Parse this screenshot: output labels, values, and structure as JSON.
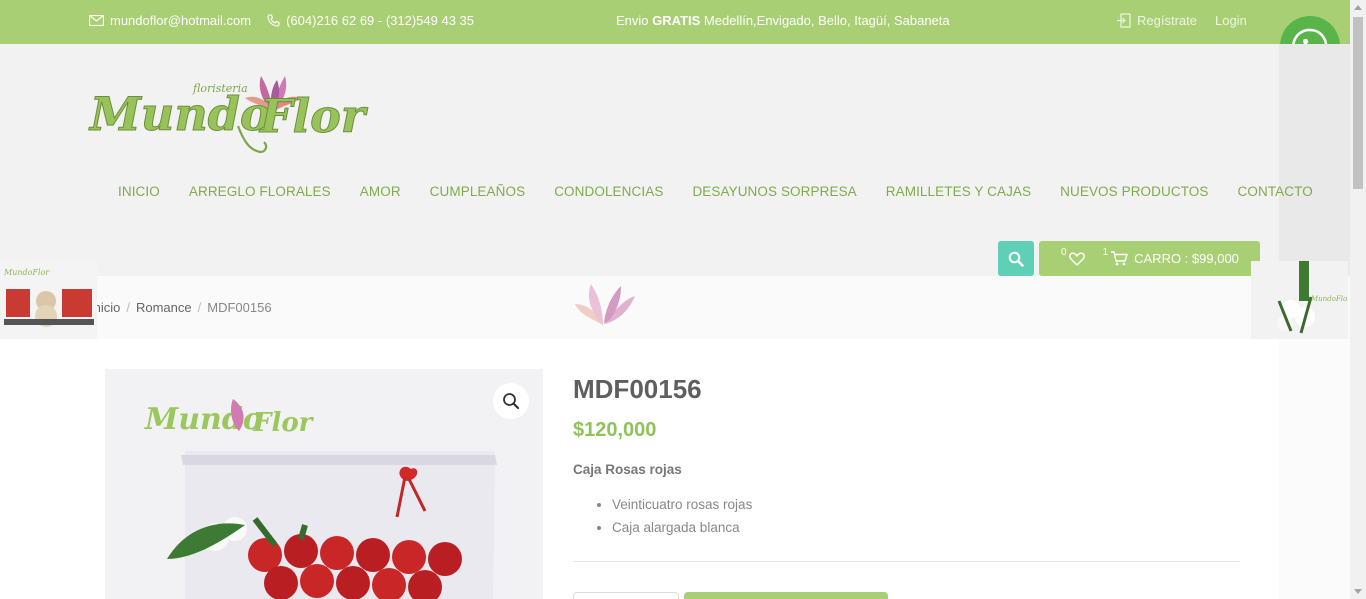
{
  "topbar": {
    "email": "mundoflor@hotmail.com",
    "phones": "(604)216 62 69 - (312)549 43 35",
    "promo_prefix": "Envio ",
    "promo_bold": "GRATIS",
    "promo_rest": " Medellín,Envigado, Bello, Itagüí, Sabaneta",
    "register_label": "Regístrate",
    "login_label": "Login"
  },
  "nav": {
    "items": [
      "INICIO",
      "ARREGLO FLORALES",
      "AMOR",
      "CUMPLEAÑOS",
      "CONDOLENCIAS",
      "DESAYUNOS SORPRESA",
      "RAMILLETES Y CAJAS",
      "NUEVOS PRODUCTOS",
      "CONTACTO"
    ]
  },
  "cart": {
    "wishlist_count": "0",
    "cart_count": "1",
    "label": "CARRO : $99,000"
  },
  "breadcrumb": {
    "home": "Inicio",
    "category": "Romance",
    "current": "MDF00156"
  },
  "product": {
    "title": "MDF00156",
    "price": "$120,000",
    "desc_title": "Caja Rosas rojas",
    "features": [
      "Veinticuatro rosas rojas",
      "Caja alargada blanca"
    ]
  },
  "colors": {
    "brand_green": "#a9cf74",
    "price_green": "#8fc25a",
    "search_teal": "#5fd0b6",
    "whatsapp": "#59b54a"
  }
}
